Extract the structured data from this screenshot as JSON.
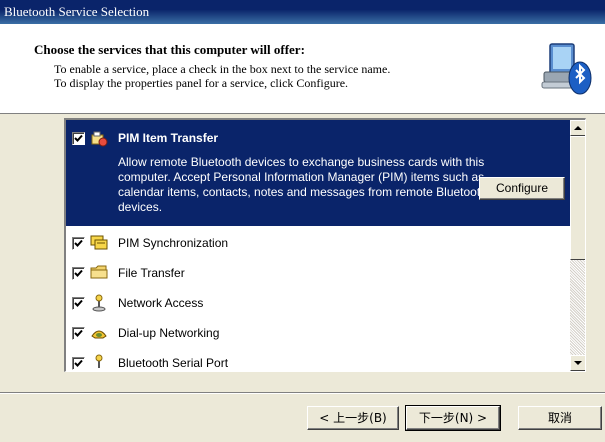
{
  "window": {
    "title": "Bluetooth Service Selection"
  },
  "header": {
    "title": "Choose the services that this computer will offer:",
    "line1": "To enable a service, place a check in the box next to the service name.",
    "line2": "To display the properties panel for a service, click Configure."
  },
  "services": {
    "selected": {
      "name": "PIM Item Transfer",
      "checked": true,
      "description": "Allow remote Bluetooth devices to exchange business cards with this computer. Accept Personal Information Manager (PIM) items such as calendar items, contacts, notes and messages from remote Bluetooth devices.",
      "configure_label": "Configure"
    },
    "items": [
      {
        "name": "PIM Synchronization",
        "checked": true,
        "icon": "pim-sync-icon"
      },
      {
        "name": "File Transfer",
        "checked": true,
        "icon": "folder-icon"
      },
      {
        "name": "Network Access",
        "checked": true,
        "icon": "network-icon"
      },
      {
        "name": "Dial-up Networking",
        "checked": true,
        "icon": "dialup-icon"
      },
      {
        "name": "Bluetooth Serial Port",
        "checked": true,
        "icon": "serial-port-icon"
      }
    ]
  },
  "buttons": {
    "back": "< 上一步(B)",
    "next": "下一步(N) >",
    "cancel": "取消"
  },
  "colors": {
    "selection": "#0a246a",
    "dialog": "#ece9d8"
  }
}
